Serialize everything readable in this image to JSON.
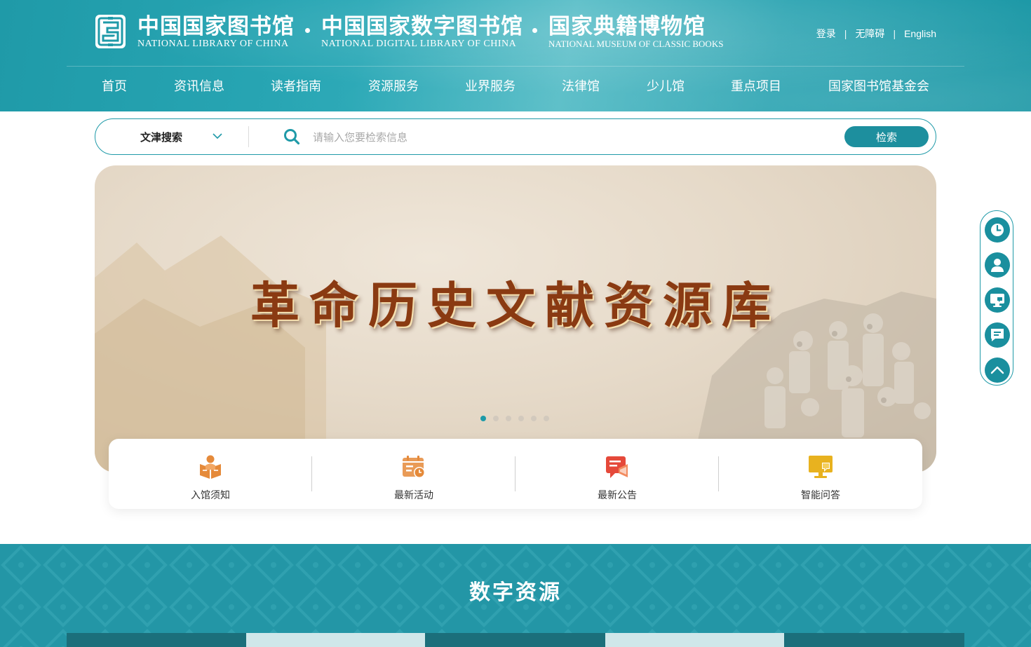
{
  "header": {
    "brands": [
      {
        "cn": "中国国家图书馆",
        "en": "NATIONAL LIBRARY OF CHINA"
      },
      {
        "cn": "中国国家数字图书馆",
        "en": "NATIONAL DIGITAL LIBRARY OF CHINA"
      },
      {
        "cn": "国家典籍博物馆",
        "en": "NATIONAL MUSEUM OF CLASSIC BOOKS"
      }
    ],
    "top_links": {
      "login": "登录",
      "accessibility": "无障碍",
      "english": "English",
      "separator": "|"
    },
    "nav": [
      "首页",
      "资讯信息",
      "读者指南",
      "资源服务",
      "业界服务",
      "法律馆",
      "少儿馆",
      "重点项目",
      "国家图书馆基金会"
    ]
  },
  "search": {
    "type_label": "文津搜索",
    "placeholder": "请输入您要检索信息",
    "value": "",
    "button_label": "检索"
  },
  "banner": {
    "title": "革命历史文献资源库",
    "slide_count": 6,
    "active_slide": 1
  },
  "quick_links": [
    {
      "label": "入馆须知",
      "icon": "reading-person-icon"
    },
    {
      "label": "最新活动",
      "icon": "calendar-clock-icon"
    },
    {
      "label": "最新公告",
      "icon": "announcement-icon"
    },
    {
      "label": "智能问答",
      "icon": "monitor-chat-icon"
    }
  ],
  "side_toolbar": [
    "clock-icon",
    "user-icon",
    "computer-icon",
    "message-icon",
    "back-to-top-icon"
  ],
  "digital": {
    "title": "数字资源"
  },
  "colors": {
    "primary": "#1f9aa8",
    "button": "#1d8f9e",
    "banner_title": "#8a3a12",
    "quick_icon_orange": "#e58a3a",
    "quick_icon_red": "#e5493a",
    "quick_icon_yellow": "#e8b21f"
  }
}
